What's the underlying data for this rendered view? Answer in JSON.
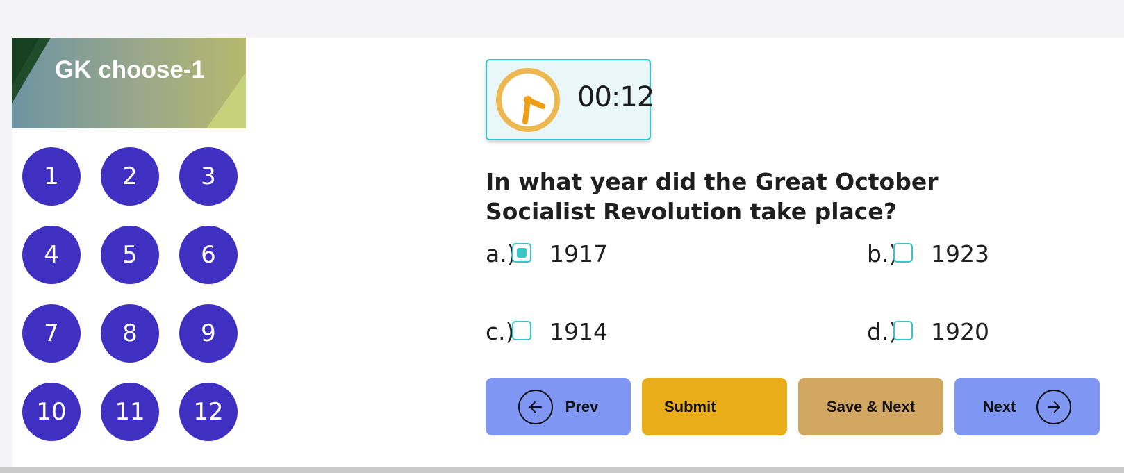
{
  "quiz": {
    "title": "GK choose-1"
  },
  "nav": {
    "questions": [
      "1",
      "2",
      "3",
      "4",
      "5",
      "6",
      "7",
      "8",
      "9",
      "10",
      "11",
      "12"
    ]
  },
  "timer": {
    "value": "00:12",
    "icon": "clock-icon"
  },
  "question": {
    "text": "In what year did the Great October Socialist Revolution take place?",
    "options": [
      {
        "letter": "a.)",
        "value": "1917",
        "checked": true
      },
      {
        "letter": "b.)",
        "value": "1923",
        "checked": false
      },
      {
        "letter": "c.)",
        "value": "1914",
        "checked": false
      },
      {
        "letter": "d.)",
        "value": "1920",
        "checked": false
      }
    ]
  },
  "buttons": {
    "prev": "Prev",
    "submit": "Submit",
    "save_next": "Save & Next",
    "next": "Next"
  },
  "colors": {
    "question_button": "#4030c2",
    "accent": "#38c7c9",
    "prev_next": "#7f96f2",
    "submit": "#eaad1a",
    "save_next": "#d2a761"
  }
}
